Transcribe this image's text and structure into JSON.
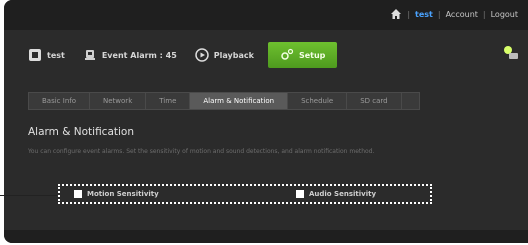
{
  "topbar": {
    "user": "test",
    "links": [
      "Account",
      "Logout"
    ]
  },
  "nav": {
    "items": [
      {
        "label": "test",
        "icon": "camera-icon"
      },
      {
        "label": "Event Alarm : 45",
        "icon": "alarm-icon"
      },
      {
        "label": "Playback",
        "icon": "play-icon"
      },
      {
        "label": "Setup",
        "icon": "gear-icon"
      }
    ]
  },
  "tabs": [
    "Basic Info",
    "Network",
    "Time",
    "Alarm & Notification",
    "Schedule",
    "SD card"
  ],
  "active_tab": "Alarm & Notification",
  "section": {
    "title": "Alarm & Notification",
    "description": "You can configure event alarms. Set the sensitivity of motion and sound detections, and alarm notification method."
  },
  "checkboxes": [
    {
      "label": "Motion Sensitivity",
      "checked": false
    },
    {
      "label": "Audio Sensitivity",
      "checked": false
    }
  ],
  "colors": {
    "accent_green": "#5aad24",
    "link_blue": "#4aa3ff"
  }
}
